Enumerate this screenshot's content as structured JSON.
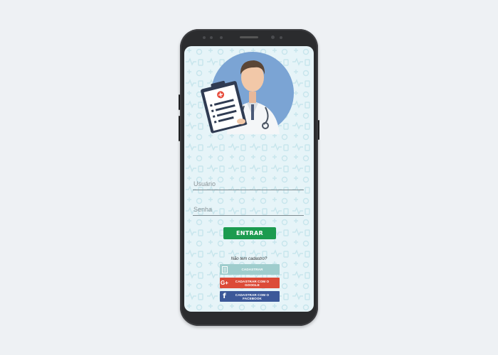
{
  "login": {
    "username_placeholder": "Usuário",
    "password_placeholder": "Senha",
    "submit_label": "ENTRAR"
  },
  "signup": {
    "prompt": "Não tem cadastro?",
    "buttons": [
      {
        "label": "CADASTRAR",
        "icon": "form-icon",
        "color": "#9fcdcd"
      },
      {
        "label": "CADASTRAR COM O GOOGLE",
        "icon": "google-plus-icon",
        "color": "#dc4b38"
      },
      {
        "label": "CADASTRAR COM O FACEBOOK",
        "icon": "facebook-icon",
        "color": "#3c5899"
      }
    ]
  },
  "colors": {
    "background": "#eef1f4",
    "screen_bg": "#e6f4f8",
    "primary": "#1c9b4f",
    "avatar_circle": "#7ba4d4"
  },
  "illustration": "doctor-with-clipboard"
}
